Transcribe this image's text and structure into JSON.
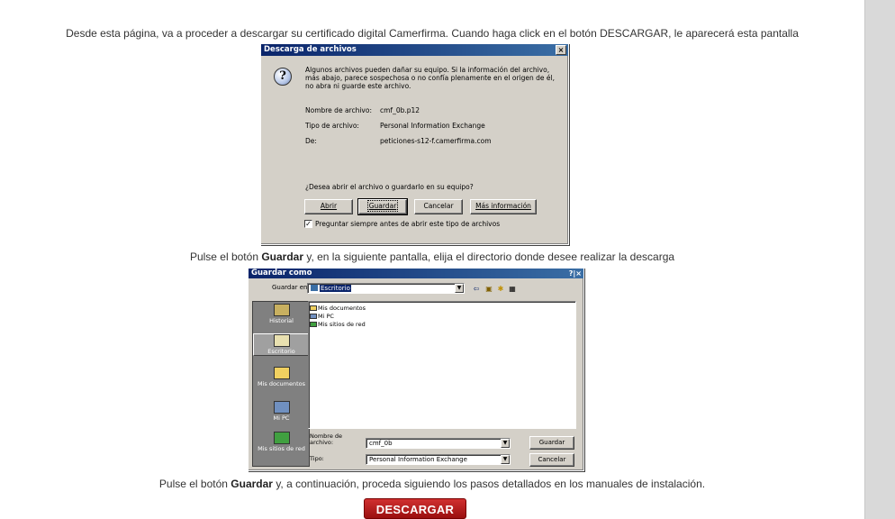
{
  "intro": "Desde esta página, va a proceder a descargar su certificado digital Camerfirma. Cuando haga click en el botón DESCARGAR, le aparecerá esta pantalla",
  "step2": {
    "before": "Pulse el botón ",
    "bold": "Guardar",
    "after": " y, en la siguiente pantalla, elija el directorio donde desee realizar la descarga"
  },
  "step3": {
    "before": "Pulse el botón ",
    "bold": "Guardar",
    "after": " y, a continuación, proceda siguiendo los pasos detallados en los manuales de instalación."
  },
  "download_button": "DESCARGAR",
  "download_dialog": {
    "title": "Descarga de archivos",
    "close": "×",
    "icon": "question-icon",
    "warning": "Algunos archivos pueden dañar su equipo. Si la información del archivo, más abajo, parece sospechosa o no confía plenamente en el origen de él, no abra ni guarde este archivo.",
    "name_label": "Nombre de archivo:",
    "name_value": "cmf_0b.p12",
    "type_label": "Tipo de archivo:",
    "type_value": "Personal Information Exchange",
    "from_label": "De:",
    "from_value": "peticiones-s12-f.camerfirma.com",
    "question": "¿Desea abrir el archivo o guardarlo en su equipo?",
    "btn_open": "Abrir",
    "btn_save": "Guardar",
    "btn_cancel": "Cancelar",
    "btn_more": "Más información",
    "checkbox_label": "Preguntar siempre antes de abrir este tipo de archivos",
    "checkbox_checked": true
  },
  "save_dialog": {
    "title": "Guardar como",
    "title_buttons": "?|×",
    "save_in_label": "Guardar en:",
    "save_in_value": "Escritorio",
    "places": [
      "Historial",
      "Escritorio",
      "Mis documentos",
      "Mi PC",
      "Mis sitios de red"
    ],
    "files": [
      "Mis documentos",
      "Mi PC",
      "Mis sitios de red"
    ],
    "filename_label": "Nombre de archivo:",
    "filename_value": "cmf_0b",
    "type_label": "Tipo:",
    "type_value": "Personal Information Exchange",
    "btn_save": "Guardar",
    "btn_cancel": "Cancelar"
  }
}
